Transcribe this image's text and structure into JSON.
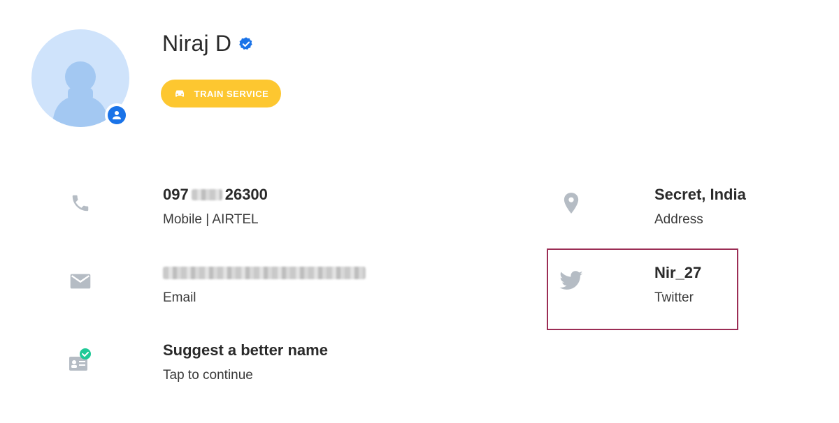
{
  "profile": {
    "name": "Niraj D",
    "badge_label": "TRAIN SERVICE",
    "icons": {
      "avatar": "person-silhouette",
      "verified": "verified-check-icon",
      "badge": "car-icon",
      "avatar_badge": "account-circle-icon"
    }
  },
  "contact": {
    "phone": {
      "number_start": "097",
      "number_end": "26300",
      "label": "Mobile | AIRTEL",
      "icon": "phone-icon"
    },
    "email": {
      "value": "",
      "label": "Email",
      "icon": "mail-icon"
    },
    "suggest": {
      "title": "Suggest a better name",
      "subtitle": "Tap to continue",
      "icon": "id-card-check-icon"
    },
    "address": {
      "value": "Secret, India",
      "label": "Address",
      "icon": "location-pin-icon"
    },
    "twitter": {
      "handle": "Nir_27",
      "label": "Twitter",
      "icon": "twitter-bird-icon"
    }
  },
  "colors": {
    "accent_blue": "#1a73e8",
    "badge_yellow": "#fdc730",
    "icon_gray": "#b5bcc4",
    "highlight_border": "#9b2d55",
    "check_green": "#20c997"
  }
}
